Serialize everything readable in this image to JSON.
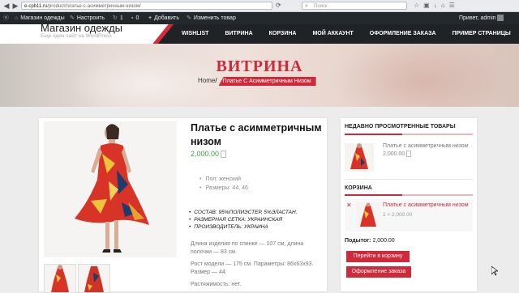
{
  "browser": {
    "url_host": "e-cpb11.ru",
    "url_path": "/product/платье-с-асимметричным-низом/",
    "search_placeholder": "Поиск",
    "back_icon": "back-arrow-icon",
    "forward_icon": "forward-arrow-icon"
  },
  "admin_bar": {
    "site_name": "Магазин одежды",
    "customize": "Настроить",
    "updates": "1",
    "comments": "0",
    "add_new": "Добавить",
    "edit": "Изменить товар",
    "greeting": "Привет, admin"
  },
  "header": {
    "site_title": "Магазин одежды",
    "tagline": "Еще один сайт на WordPress",
    "menu": [
      "WISHLIST",
      "ВИТРИНА",
      "КОРЗИНА",
      "МОЙ АККАУНТ",
      "ОФОРМЛЕНИЕ ЗАКАЗА",
      "ПРИМЕР СТРАНИЦЫ"
    ]
  },
  "hero": {
    "title": "ВИТРИНА",
    "breadcrumb_home": "Home",
    "breadcrumb_sep": "/",
    "breadcrumb_current": "Платье С Асимметричным Низом"
  },
  "product": {
    "title": "Платье с асимметричным низом",
    "price": "2,000.00",
    "attributes": [
      "Пол: женский",
      "Размеры: 44, 46"
    ],
    "features": [
      "СОСТАВ: 95%ПОЛИЭСТЕР, 5%ЭЛАСТАН.",
      "РАЗМЕРНАЯ СЕТКА: УКРАИНСКАЯ",
      "ПРОИЗВОДИТЕЛЬ: УКРАИНА"
    ],
    "description": [
      "Длина изделия по спинке — 107 см, длина полочки — 83 см.",
      "Рост модели — 175 см. Параметры: 86х63х93. Размер — 44.",
      "Растяжимость: нет."
    ]
  },
  "sidebar": {
    "recent_title": "НЕДАВНО ПРОСМОТРЕННЫЕ ТОВАРЫ",
    "recent_item_name": "Платье с асимметричным низом",
    "recent_item_price": "2,000.00",
    "cart_title": "КОРЗИНА",
    "cart_item_name": "Платье с асимметричным низом",
    "cart_item_qty": "1 × 2,000.00",
    "subtotal_label": "Подытог:",
    "subtotal_value": "2,000.00",
    "view_cart_button": "Перейти в корзину",
    "checkout_button": "Оформление заказа"
  },
  "colors": {
    "accent": "#d0293a",
    "admin_bar": "#23282d",
    "header": "#1f2326",
    "price": "#3c9d3c"
  }
}
